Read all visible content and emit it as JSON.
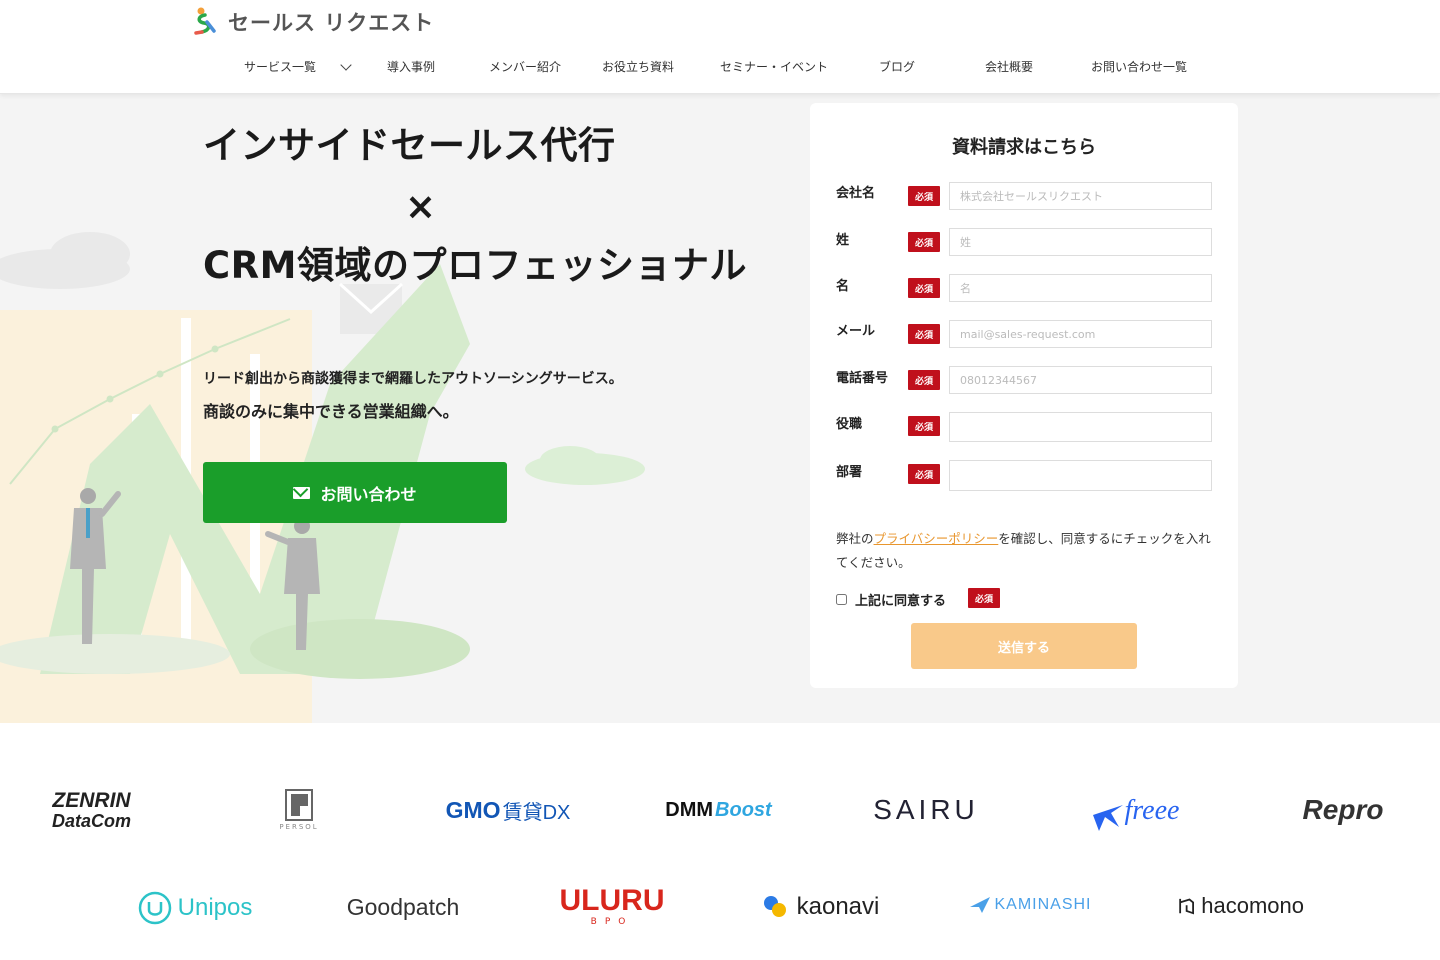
{
  "header": {
    "logo_text": "セールス リクエスト",
    "nav": [
      {
        "label": "サービス一覧",
        "has_dropdown": true
      },
      {
        "label": "導入事例"
      },
      {
        "label": "メンバー紹介"
      },
      {
        "label": "お役立ち資料"
      },
      {
        "label": "セミナー・イベント"
      },
      {
        "label": "ブログ"
      },
      {
        "label": "会社概要"
      },
      {
        "label": "お問い合わせ一覧"
      }
    ]
  },
  "hero": {
    "title_line1": "インサイドセールス代行",
    "title_line2": "×",
    "title_line3": "CRM領域のプロフェッショナル",
    "subtitle1": "リード創出から商談獲得まで網羅したアウトソーシングサービス。",
    "subtitle2": "商談のみに集中できる営業組織へ。",
    "cta_label": "お問い合わせ"
  },
  "form": {
    "title": "資料請求はこちら",
    "required_badge": "必須",
    "fields": [
      {
        "label": "会社名",
        "placeholder": "株式会社セールスリクエスト"
      },
      {
        "label": "姓",
        "placeholder": "姓"
      },
      {
        "label": "名",
        "placeholder": "名"
      },
      {
        "label": "メール",
        "placeholder": "mail@sales-request.com"
      },
      {
        "label": "電話番号",
        "placeholder": "08012344567"
      },
      {
        "label": "役職",
        "placeholder": ""
      },
      {
        "label": "部署",
        "placeholder": ""
      }
    ],
    "consent_before": "弊社の",
    "consent_link": "プライバシーポリシー",
    "consent_after": "を確認し、同意するにチェックを入れてください。",
    "agree_label": "上記に同意する",
    "submit_label": "送信する"
  },
  "client_logos": {
    "row1": [
      "ZENRIN DataCom",
      "PERSOL",
      "GMO賃貸DX",
      "DMM Boost",
      "SAIRU",
      "freee",
      "Repro"
    ],
    "row2": [
      "Unipos",
      "Goodpatch",
      "ULURU BPO",
      "kaonavi",
      "KAMINASHI",
      "hacomono"
    ]
  },
  "colors": {
    "accent_green": "#1a9e2a",
    "required_red": "#c0101c",
    "submit_orange": "#f9c98a",
    "link_orange": "#e8962e"
  }
}
